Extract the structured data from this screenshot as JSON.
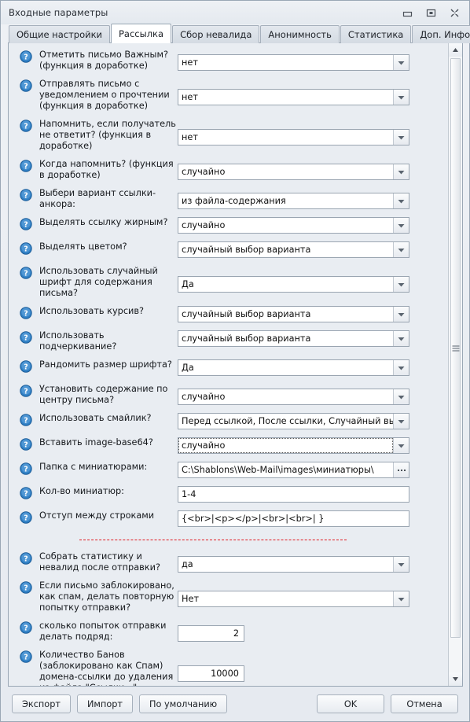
{
  "window": {
    "title": "Входные параметры",
    "buttons": {
      "minimize": "minimize-icon",
      "restore": "restore-icon",
      "close": "close-icon"
    }
  },
  "tabs": [
    {
      "label": "Общие настройки",
      "active": false
    },
    {
      "label": "Рассылка",
      "active": true
    },
    {
      "label": "Сбор невалида",
      "active": false
    },
    {
      "label": "Анонимность",
      "active": false
    },
    {
      "label": "Статистика",
      "active": false
    },
    {
      "label": "Доп. Информация",
      "active": false
    }
  ],
  "form": {
    "help_icon": "help-icon",
    "rows": [
      {
        "label": "Отметить письмо Важным? (функция в доработке)",
        "type": "combo",
        "value": "нет",
        "lines": 2
      },
      {
        "label": "Отправлять письмо с уведомлением о прочтении (функция в доработке)",
        "type": "combo",
        "value": "нет",
        "lines": 3
      },
      {
        "label": "Напомнить, если получатель не ответит? (функция в доработке)",
        "type": "combo",
        "value": "нет",
        "lines": 3
      },
      {
        "label": "Когда напомнить? (функция в доработке)",
        "type": "combo",
        "value": "случайно",
        "lines": 2
      },
      {
        "label": "Выбери вариант ссылки-анкора:",
        "type": "combo",
        "value": "из файла-содержания",
        "lines": 2
      },
      {
        "label": "Выделять ссылку жирным?",
        "type": "combo",
        "value": "случайно",
        "lines": 1
      },
      {
        "label": "Выделять цветом?",
        "type": "combo",
        "value": "случайный выбор варианта",
        "lines": 1
      },
      {
        "label": "Использовать случайный шрифт для содержания письма?",
        "type": "combo",
        "value": "Да",
        "lines": 3
      },
      {
        "label": "Использовать курсив?",
        "type": "combo",
        "value": "случайный выбор варианта",
        "lines": 1
      },
      {
        "label": "Использовать подчеркивание?",
        "type": "combo",
        "value": "случайный выбор варианта",
        "lines": 1
      },
      {
        "label": "Рандомить размер шрифта?",
        "type": "combo",
        "value": "Да",
        "lines": 1
      },
      {
        "label": "Установить содержание по центру письма?",
        "type": "combo",
        "value": "случайно",
        "lines": 2
      },
      {
        "label": "Использовать смайлик?",
        "type": "combo",
        "value": "Перед ссылкой, После ссылки, Случайный выбор",
        "lines": 1
      },
      {
        "label": "Вставить image-base64?",
        "type": "combo",
        "value": "случайно",
        "focused": true,
        "lines": 1
      },
      {
        "label": "Папка с миниатюрами:",
        "type": "path",
        "value": "C:\\Shablons\\Web-Mail\\images\\миниатюры\\",
        "browse_label": "browse-ellipsis-icon",
        "lines": 1
      },
      {
        "label": "Кол-во миниатюр:",
        "type": "text",
        "value": "1-4",
        "lines": 1
      },
      {
        "label": "Отступ между строками",
        "type": "text",
        "value": "{<br>|<p></p>|<br>|<br>| }",
        "lines": 1
      },
      {
        "type": "separator"
      },
      {
        "label": "Собрать статистику и невалид после отправки?",
        "type": "combo",
        "value": "да",
        "lines": 2
      },
      {
        "label": "Если письмо заблокировано, как спам, делать повторную попытку отправки?",
        "type": "combo",
        "value": "Нет",
        "lines": 3
      },
      {
        "label": "сколько попыток отправки делать подряд:",
        "type": "number",
        "value": "2",
        "lines": 2
      },
      {
        "label": "Количество Банов (заблокировано как Спам) домена-ссылки до удаления из файла \"Ссылки...\":",
        "type": "number",
        "value": "10000",
        "lines": 4
      }
    ]
  },
  "scrollbar": {
    "up_icon": "scroll-up-icon",
    "down_icon": "scroll-down-icon",
    "grip": "scroll-thumb-grip"
  },
  "footer": {
    "export": "Экспорт",
    "import": "Импорт",
    "defaults": "По умолчанию",
    "ok": "OK",
    "cancel": "Отмена"
  },
  "colors": {
    "accent_blue": "#2f7fc4",
    "separator_red": "#e11b22",
    "panel_bg": "#e9edf2",
    "field_bg": "#ffffff",
    "border": "#9aa5b1"
  }
}
